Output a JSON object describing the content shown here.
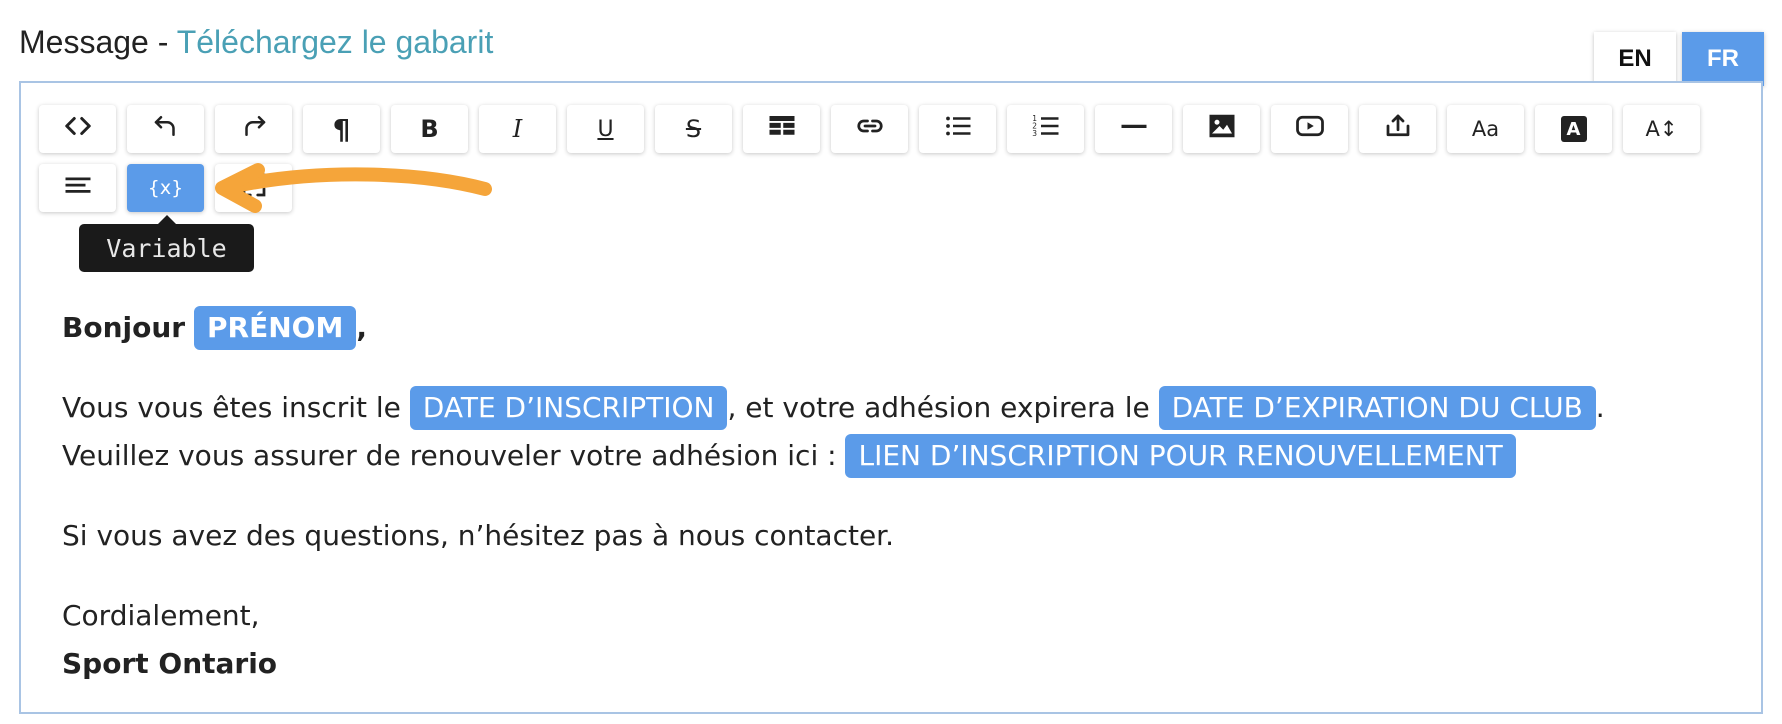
{
  "header": {
    "title": "Message",
    "separator": " - ",
    "template_link": "Téléchargez le gabarit"
  },
  "languages": {
    "en": "EN",
    "fr": "FR",
    "active": "FR"
  },
  "toolbar": {
    "row1": [
      {
        "name": "code-view-button",
        "icon": "code-icon"
      },
      {
        "name": "undo-button",
        "icon": "undo-icon"
      },
      {
        "name": "redo-button",
        "icon": "redo-icon"
      },
      {
        "name": "paragraph-button",
        "icon": "paragraph-icon",
        "glyph": "¶"
      },
      {
        "name": "bold-button",
        "icon": "bold-icon",
        "glyph": "B"
      },
      {
        "name": "italic-button",
        "icon": "italic-icon",
        "glyph": "I"
      },
      {
        "name": "underline-button",
        "icon": "underline-icon",
        "glyph": "U"
      },
      {
        "name": "strikethrough-button",
        "icon": "strikethrough-icon",
        "glyph": "S"
      },
      {
        "name": "table-button",
        "icon": "table-icon"
      },
      {
        "name": "link-button",
        "icon": "link-icon"
      },
      {
        "name": "bullet-list-button",
        "icon": "bullet-list-icon"
      },
      {
        "name": "numbered-list-button",
        "icon": "numbered-list-icon"
      },
      {
        "name": "horizontal-rule-button",
        "icon": "horizontal-rule-icon"
      },
      {
        "name": "image-button",
        "icon": "image-icon"
      },
      {
        "name": "video-button",
        "icon": "video-icon"
      },
      {
        "name": "upload-button",
        "icon": "upload-icon"
      },
      {
        "name": "font-button",
        "icon": "font-icon",
        "glyph": "Aa"
      },
      {
        "name": "text-color-button",
        "icon": "text-color-icon",
        "glyph": "A"
      },
      {
        "name": "font-size-button",
        "icon": "font-size-icon",
        "glyph": "A↕"
      }
    ],
    "row2": [
      {
        "name": "align-button",
        "icon": "align-left-icon"
      },
      {
        "name": "variable-button",
        "icon": "variable-icon",
        "glyph": "{x}",
        "active": true
      },
      {
        "name": "fullscreen-button",
        "icon": "fullscreen-icon"
      }
    ]
  },
  "tooltip": {
    "text": "Variable"
  },
  "body": {
    "greeting_prefix": "Bonjour",
    "greeting_suffix": ",",
    "var_first_name": "PRÉNOM",
    "line1_prefix": "Vous vous êtes inscrit le",
    "var_registration_date": "DATE D’INSCRIPTION",
    "line1_middle": ", et votre adhésion expirera le",
    "var_expiration_date": "DATE D’EXPIRATION DU CLUB",
    "line1_suffix": ".",
    "line2_prefix": "Veuillez vous assurer de renouveler votre adhésion ici :",
    "var_renewal_link": "LIEN D’INSCRIPTION POUR RENOUVELLEMENT",
    "questions": "Si vous avez des questions, n’hésitez pas à nous contacter.",
    "closing": "Cordialement,",
    "signature": "Sport Ontario"
  },
  "colors": {
    "accent": "#5b9be9",
    "link": "#4aa0b5",
    "annotation_arrow": "#f5a53a",
    "editor_border": "#a9c4e4"
  }
}
